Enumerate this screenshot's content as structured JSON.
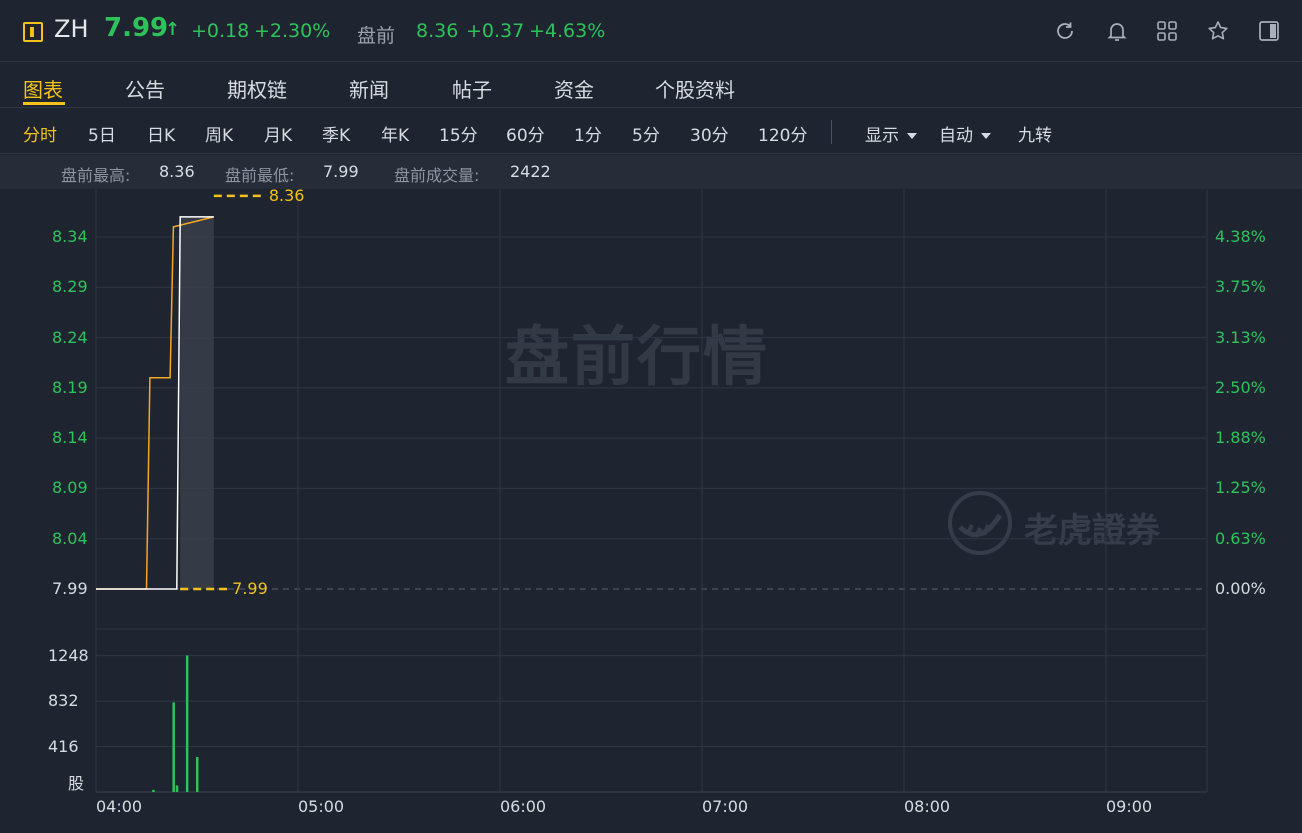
{
  "header": {
    "ticker": "ZH",
    "price": "7.99",
    "arrow": "↑",
    "change": "+0.18",
    "change_pct": "+2.30%",
    "premarket_label": "盘前",
    "premarket_price": "8.36",
    "premarket_change": "+0.37",
    "premarket_pct": "+4.63%",
    "icons": [
      "refresh-icon",
      "bell-icon",
      "grid-icon",
      "star-icon",
      "panel-toggle-icon"
    ]
  },
  "tabs": [
    {
      "label": "图表",
      "active": true
    },
    {
      "label": "公告"
    },
    {
      "label": "期权链"
    },
    {
      "label": "新闻"
    },
    {
      "label": "帖子"
    },
    {
      "label": "资金"
    },
    {
      "label": "个股资料"
    }
  ],
  "periods": {
    "items": [
      "分时",
      "5日",
      "日K",
      "周K",
      "月K",
      "季K",
      "年K",
      "15分",
      "60分",
      "1分",
      "5分",
      "30分",
      "120分"
    ],
    "active": "分时",
    "display_label": "显示",
    "auto_label": "自动",
    "jiuzhuan_label": "九转"
  },
  "stats": {
    "high_label": "盘前最高:",
    "high_value": "8.36",
    "low_label": "盘前最低:",
    "low_value": "7.99",
    "volume_label": "盘前成交量:",
    "volume_value": "2422"
  },
  "chart_data": {
    "type": "line",
    "watermark": "盘前行情",
    "brand_watermark": "老虎證券",
    "base_price": 7.99,
    "y_ticks": [
      "8.34",
      "8.29",
      "8.24",
      "8.19",
      "8.14",
      "8.09",
      "8.04",
      "7.99"
    ],
    "y_right_ticks": [
      "4.38%",
      "3.75%",
      "3.13%",
      "2.50%",
      "1.88%",
      "1.25%",
      "0.63%",
      "0.00%"
    ],
    "ylim": [
      7.99,
      8.36
    ],
    "x_ticks": [
      "04:00",
      "05:00",
      "06:00",
      "07:00",
      "08:00",
      "09:00"
    ],
    "high_marker": "8.36",
    "low_marker": "7.99",
    "price_series": {
      "name": "price",
      "color": "#ffffff",
      "points": [
        [
          "04:00",
          7.99
        ],
        [
          "04:24",
          7.99
        ],
        [
          "04:25",
          8.36
        ],
        [
          "04:35",
          8.36
        ]
      ]
    },
    "avg_series": {
      "name": "avg",
      "color": "#f5a623",
      "points": [
        [
          "04:00",
          7.99
        ],
        [
          "04:15",
          7.99
        ],
        [
          "04:16",
          8.2
        ],
        [
          "04:22",
          8.2
        ],
        [
          "04:23",
          8.35
        ],
        [
          "04:35",
          8.36
        ]
      ]
    },
    "volume": {
      "y_ticks": [
        "1248",
        "832",
        "416"
      ],
      "unit": "股",
      "bars": [
        [
          "04:17",
          20
        ],
        [
          "04:23",
          820
        ],
        [
          "04:24",
          60
        ],
        [
          "04:27",
          1250
        ],
        [
          "04:30",
          320
        ]
      ],
      "color": "#2ec25b"
    }
  }
}
